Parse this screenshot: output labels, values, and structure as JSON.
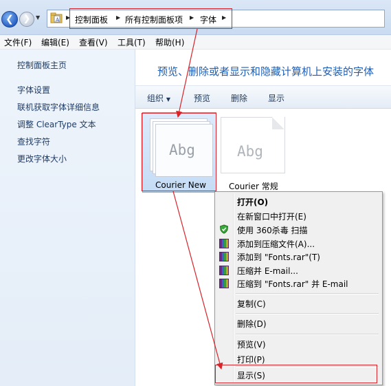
{
  "address_bar": {
    "breadcrumbs": [
      "控制面板",
      "所有控制面板项",
      "字体"
    ],
    "icons": {
      "back": "back-arrow-icon",
      "forward": "forward-arrow-icon",
      "folder": "control-panel-folder-icon"
    }
  },
  "menubar": {
    "items": [
      "文件(F)",
      "编辑(E)",
      "查看(V)",
      "工具(T)",
      "帮助(H)"
    ]
  },
  "sidebar": {
    "home": "控制面板主页",
    "links": [
      "字体设置",
      "联机获取字体详细信息",
      "调整 ClearType 文本",
      "查找字符",
      "更改字体大小"
    ]
  },
  "main": {
    "title": "预览、删除或者显示和隐藏计算机上安装的字体",
    "toolbar": {
      "organize": "组织",
      "organize_arrow": "▼",
      "preview": "预览",
      "delete": "删除",
      "show": "显示"
    },
    "fonts": [
      {
        "thumb_text": "Abg",
        "name": "Courier New",
        "selected": true
      },
      {
        "thumb_text": "Abg",
        "name": "Courier 常规",
        "selected": false
      }
    ]
  },
  "context_menu": {
    "open": "打开(O)",
    "open_new_window": "在新窗口中打开(E)",
    "scan_360": "使用 360杀毒 扫描",
    "add_to_archive": "添加到压缩文件(A)...",
    "add_to_fonts_rar": "添加到 \"Fonts.rar\"(T)",
    "compress_email": "压缩并 E-mail...",
    "compress_fonts_rar_email": "压缩到 \"Fonts.rar\" 并 E-mail",
    "copy": "复制(C)",
    "delete": "删除(D)",
    "preview": "预览(V)",
    "print": "打印(P)",
    "show": "显示(S)",
    "icons": {
      "scan_360": "shield-360-icon",
      "winrar": "winrar-books-icon"
    }
  },
  "colors": {
    "annotation_red": "#d7232a",
    "title_blue": "#1e5eb6",
    "selection_blue": "#c5dcf6"
  }
}
